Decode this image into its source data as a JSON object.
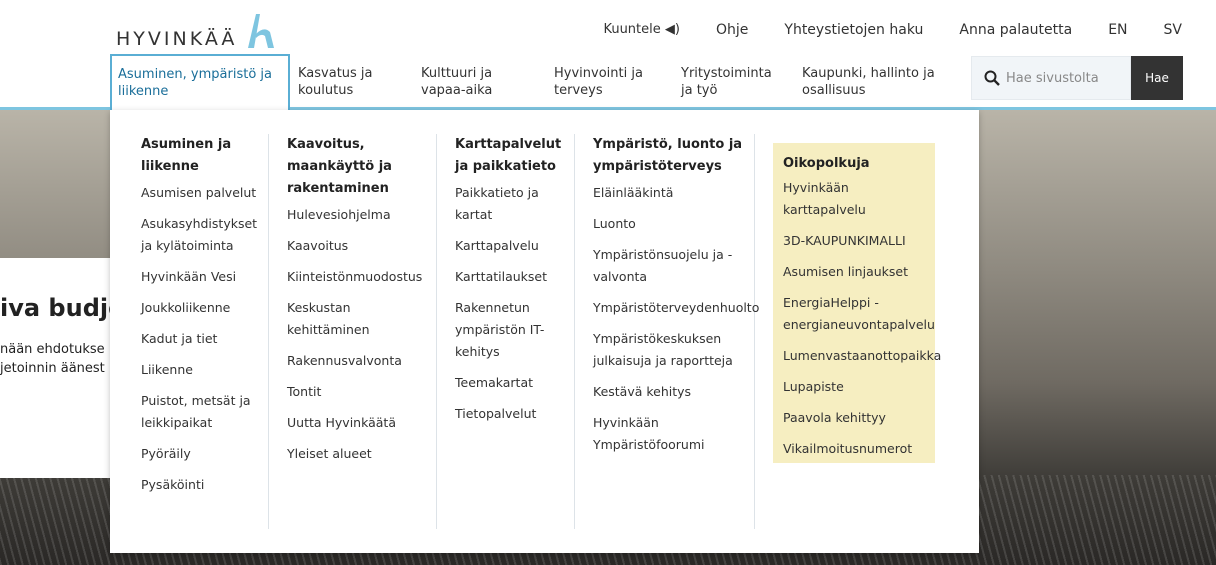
{
  "logo": {
    "text": "HYVINKÄÄ"
  },
  "toplinks": {
    "listen": "Kuuntele",
    "help": "Ohje",
    "contacts": "Yhteystietojen haku",
    "feedback": "Anna palautetta",
    "en": "EN",
    "sv": "SV"
  },
  "nav": [
    {
      "label": "Asuminen, ympäristö ja liikenne"
    },
    {
      "label": "Kasvatus ja koulutus"
    },
    {
      "label": "Kulttuuri ja vapaa-aika"
    },
    {
      "label": "Hyvinvointi ja terveys"
    },
    {
      "label": "Yritystoiminta ja työ"
    },
    {
      "label": "Kaupunki, hallinto ja osallisuus"
    }
  ],
  "search": {
    "placeholder": "Hae sivustolta",
    "button": "Hae"
  },
  "hero": {
    "title": "iva budje",
    "text1": "nään ehdotukse",
    "text2": "jetoinnin äänest"
  },
  "menu": {
    "col1": {
      "heading": "Asuminen ja liikenne",
      "links": [
        "Asumisen palvelut",
        "Asukasyhdistykset ja kylätoiminta",
        "Hyvinkään Vesi",
        "Joukkoliikenne",
        "Kadut ja tiet",
        "Liikenne",
        "Puistot, metsät ja leikkipaikat",
        "Pyöräily",
        "Pysäköinti"
      ]
    },
    "col2": {
      "heading": "Kaavoitus, maankäyttö ja rakentaminen",
      "links": [
        "Hulevesiohjelma",
        "Kaavoitus",
        "Kiinteistönmuodostus",
        "Keskustan kehittäminen",
        "Rakennusvalvonta",
        "Tontit",
        "Uutta Hyvinkäätä",
        "Yleiset alueet"
      ]
    },
    "col3": {
      "heading": "Karttapalvelut ja paikkatieto",
      "links": [
        "Paikkatieto ja kartat",
        "Karttapalvelu",
        "Karttatilaukset",
        "Rakennetun ympäristön IT-kehitys",
        "Teemakartat",
        "Tietopalvelut"
      ]
    },
    "col4": {
      "heading": "Ympäristö, luonto ja ympäristöterveys",
      "links": [
        "Eläinlääkintä",
        "Luonto",
        "Ympäristönsuojelu ja -valvonta",
        "Ympäristöterveydenhuolto",
        "Ympäristökeskuksen julkaisuja ja raportteja",
        "Kestävä kehitys",
        "Hyvinkään Ympäristöfoorumi"
      ]
    },
    "shortcuts": {
      "heading": "Oikopolkuja",
      "links": [
        "Hyvinkään karttapalvelu",
        "3D-KAUPUNKIMALLI",
        "Asumisen linjaukset",
        "EnergiaHelppi - energianeuvontapalvelu",
        "Lumenvastaanottopaikka",
        "Lupapiste",
        "Paavola kehittyy",
        "Vikailmoitusnumerot"
      ]
    }
  }
}
